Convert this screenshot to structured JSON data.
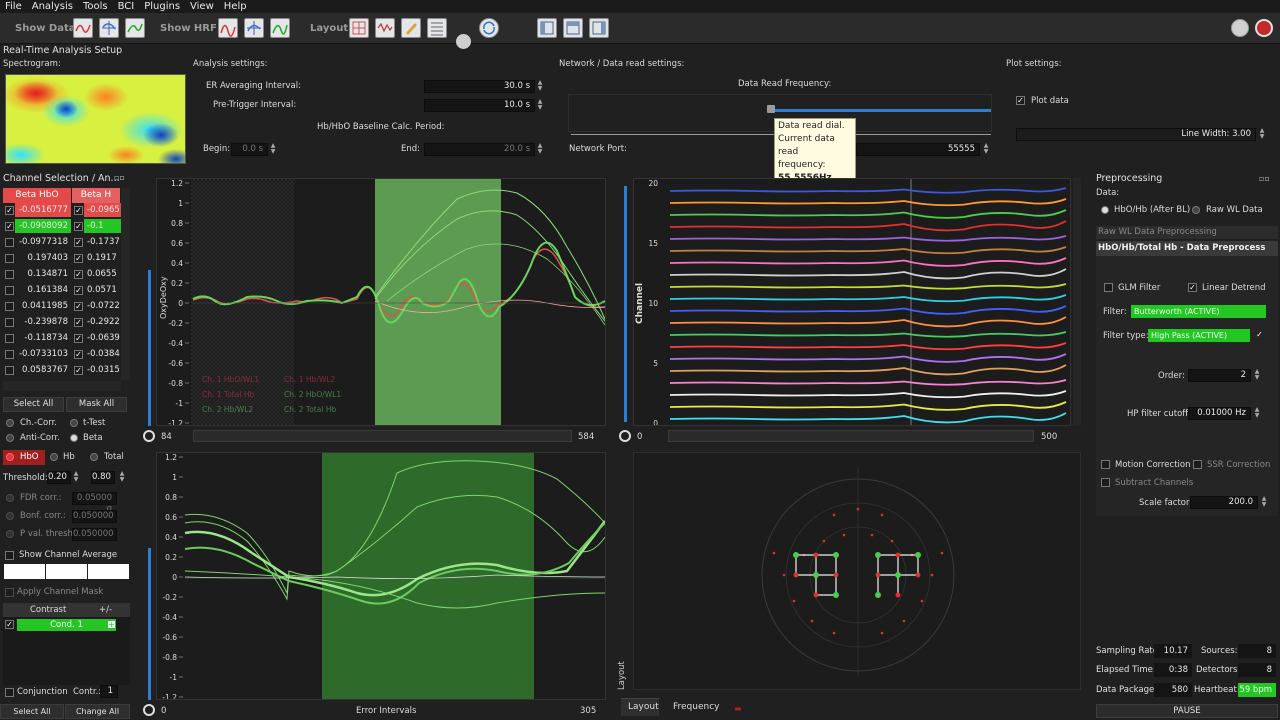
{
  "menu": [
    "File",
    "Analysis",
    "Tools",
    "BCI",
    "Plugins",
    "View",
    "Help"
  ],
  "toolbar": {
    "show_data": "Show Data",
    "show_hrf": "Show HRF",
    "layout": "Layout"
  },
  "colors": {
    "accent_blue": "#2b7fd3",
    "green_active": "#23c623",
    "red_hbo": "#e03a3a",
    "region_green": "#5d9a52"
  },
  "realtime": {
    "title": "Real-Time Analysis Setup",
    "spectrogram_label": "Spectrogram:",
    "analysis_label": "Analysis settings:",
    "er_avg_label": "ER Averaging Interval:",
    "er_avg_value": "30.0 s",
    "pretrigger_label": "Pre-Trigger Interval:",
    "pretrigger_value": "10.0 s",
    "baseline_label": "Hb/HbO Baseline Calc. Period:",
    "begin_label": "Begin:",
    "begin_value": "0.0 s",
    "end_label": "End:",
    "end_value": "20.0 s",
    "network_label": "Network / Data read settings:",
    "read_freq_label": "Data Read Frequency:",
    "network_port_label": "Network Port:",
    "network_port_value": "55555",
    "plot_settings_label": "Plot settings:",
    "plot_data_label": "Plot data",
    "line_width_label": "Line Width: 3.00"
  },
  "tooltip": {
    "line1": "Data read dial.",
    "line2": "Current data read",
    "line3": "frequency:",
    "value": "55.5556Hz"
  },
  "channel_selection": {
    "title": "Channel Selection / An...",
    "col1": "Beta HbO",
    "col2": "Beta H",
    "rows": [
      {
        "a": "-0.0516777",
        "b": "-0.0965"
      },
      {
        "a": "-0.0908092",
        "b": "-0.1"
      },
      {
        "a": "-0.0977318",
        "b": "-0.1737"
      },
      {
        "a": "0.197403",
        "b": "0.1917"
      },
      {
        "a": "0.134871",
        "b": "0.0655"
      },
      {
        "a": "0.161384",
        "b": "0.0571"
      },
      {
        "a": "0.0411985",
        "b": "-0.0722"
      },
      {
        "a": "-0.239878",
        "b": "-0.2922"
      },
      {
        "a": "-0.118734",
        "b": "-0.0639"
      },
      {
        "a": "-0.0733103",
        "b": "-0.0384"
      },
      {
        "a": "0.0583767",
        "b": "-0.0315"
      }
    ],
    "select_all": "Select All",
    "mask_all": "Mask All",
    "ch_corr": "Ch.-Corr.",
    "t_test": "t-Test",
    "anti_corr": "Anti-Corr.",
    "beta": "Beta",
    "hbo": "HbO",
    "hb": "Hb",
    "total": "Total",
    "threshold_label": "Threshold:",
    "threshold_low": "0.20",
    "threshold_high": "0.80",
    "fdr_label": "FDR corr.:",
    "fdr_value": "0.05000 q",
    "bonf_label": "Bonf. corr.:",
    "bonf_value": "0.050000",
    "pval_label": "P val. thresh.:",
    "pval_value": "0.050000",
    "show_avg": "Show Channel Average",
    "apply_mask": "Apply Channel Mask",
    "contrast_label": "Contrast",
    "contrast_plus": "+/-",
    "cond1": "Cond. 1",
    "conjunction": "Conjunction",
    "contr_label": "Contr.:",
    "contr_value": "1",
    "select_all_conds": "Select All conds",
    "change_all_values": "Change All Values"
  },
  "plot1": {
    "ylabel": "OxyDeOxy",
    "yticks": [
      "1.2",
      "1",
      "0.8",
      "0.6",
      "0.4",
      "0.2",
      "0",
      "-0.2",
      "-0.4",
      "-0.6",
      "-0.8",
      "-1",
      "-1.2"
    ],
    "legend": [
      "Ch. 1 HbO/WL1",
      "Ch. 1 Hb/WL2",
      "Ch. 1 Total Hb",
      "Ch. 2 HbO/WL1",
      "Ch. 2 Hb/WL2",
      "Ch. 2 Total Hb"
    ],
    "scroll_left": "84",
    "scroll_right": "584"
  },
  "plot2": {
    "ylabel": "Channel",
    "yticks": [
      "20",
      "15",
      "10",
      "5",
      "0"
    ],
    "scroll_left": "0",
    "scroll_right": "500"
  },
  "plot3": {
    "yticks": [
      "1.2",
      "1",
      "0.8",
      "0.6",
      "0.4",
      "0.2",
      "0",
      "-0.2",
      "-0.4",
      "-0.6",
      "-0.8",
      "-1",
      "-1.2"
    ],
    "scroll_left": "0",
    "scroll_mid": "Error Intervals",
    "scroll_right": "305"
  },
  "layout_view": {
    "side_label": "Layout",
    "tab_layout": "Layout",
    "tab_frequency": "Frequency"
  },
  "preprocessing": {
    "title": "Preprocessing",
    "data_label": "Data:",
    "opt_hbo": "HbO/Hb (After BL)",
    "opt_raw": "Raw WL Data",
    "raw_tab": "Raw WL Data Preprocessing",
    "hb_tab": "HbO/Hb/Total Hb - Data Preprocess",
    "glm": "GLM Filter",
    "linear_detrend": "Linear Detrend",
    "filter_label": "Filter:",
    "filter_value": "Butterworth (ACTIVE)",
    "filter_type_label": "Filter type:",
    "filter_type_value": "High Pass (ACTIVE)",
    "order_label": "Order:",
    "order_value": "2",
    "hp_label": "HP filter cutoff:",
    "hp_value": "0.01000 Hz",
    "motion": "Motion Correction",
    "ssr": "SSR Correction",
    "subtract": "Subtract Channels",
    "scale_label": "Scale factor:",
    "scale_value": "200.0"
  },
  "status": {
    "sampling_label": "Sampling Rate:",
    "sampling_value": "10.17",
    "sources_label": "Sources:",
    "sources_value": "8",
    "elapsed_label": "Elapsed Time:",
    "elapsed_value": "0:38",
    "detectors_label": "Detectors:",
    "detectors_value": "8",
    "package_label": "Data Package:",
    "package_value": "580",
    "heartbeat_label": "Heartbeat:",
    "heartbeat_value": "59 bpm",
    "pause": "PAUSE"
  }
}
